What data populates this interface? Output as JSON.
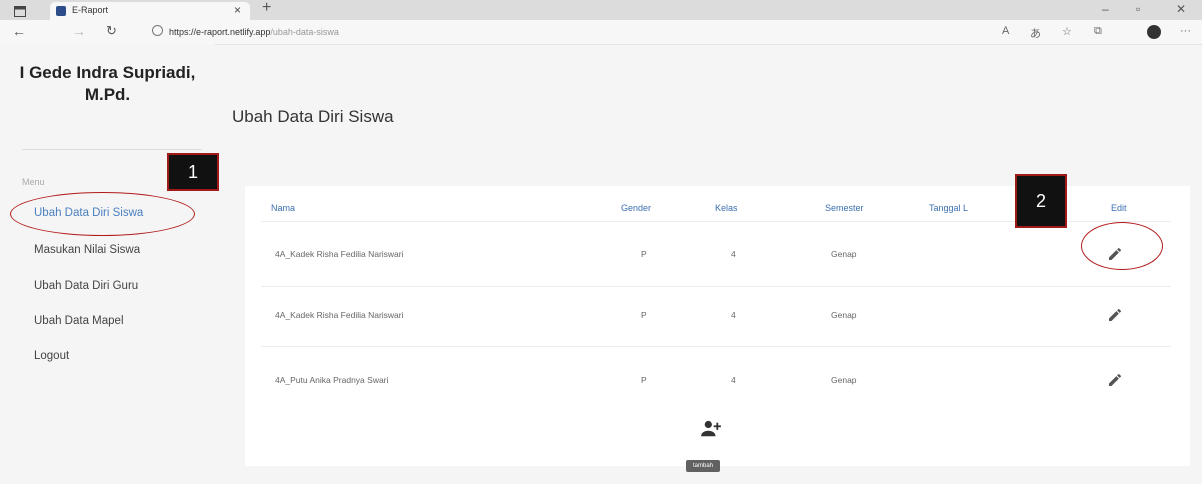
{
  "browser": {
    "tab_title": "E-Raport",
    "tab_close": "×",
    "new_tab": "+",
    "url_host": "https://e-raport.netlify.app",
    "url_path": "/ubah-data-siswa",
    "icons": [
      "window-icon",
      "favicon",
      "back-icon",
      "forward-icon",
      "reload-icon",
      "lock-icon",
      "read-aloud-icon",
      "translate-icon",
      "favorites-icon",
      "collections-icon",
      "profile-icon",
      "more-icon"
    ]
  },
  "sidebar": {
    "teacher_name": "I Gede Indra Supriadi, M.Pd.",
    "menu_label": "Menu",
    "items": [
      {
        "label": "Ubah Data Diri Siswa",
        "active": true
      },
      {
        "label": "Masukan Nilai Siswa"
      },
      {
        "label": "Ubah Data Diri Guru"
      },
      {
        "label": "Ubah Data Mapel"
      },
      {
        "label": "Logout"
      }
    ]
  },
  "main": {
    "title": "Ubah Data Diri Siswa",
    "columns": [
      "Nama",
      "Gender",
      "Kelas",
      "Semester",
      "Tanggal L",
      "Edit"
    ],
    "rows": [
      {
        "nama": "4A_Kadek Risha Fedilia Nariswari",
        "gender": "P",
        "kelas": "4",
        "semester": "Genap"
      },
      {
        "nama": "4A_Kadek Risha Fedilia Nariswari",
        "gender": "P",
        "kelas": "4",
        "semester": "Genap"
      },
      {
        "nama": "4A_Putu Anika Pradnya Swari",
        "gender": "P",
        "kelas": "4",
        "semester": "Genap"
      }
    ],
    "add_tooltip": "tambah"
  },
  "annotations": {
    "marker1": "1",
    "marker2": "2"
  },
  "colors": {
    "accent": "#4a7fc0",
    "highlight": "#b21a1a"
  }
}
